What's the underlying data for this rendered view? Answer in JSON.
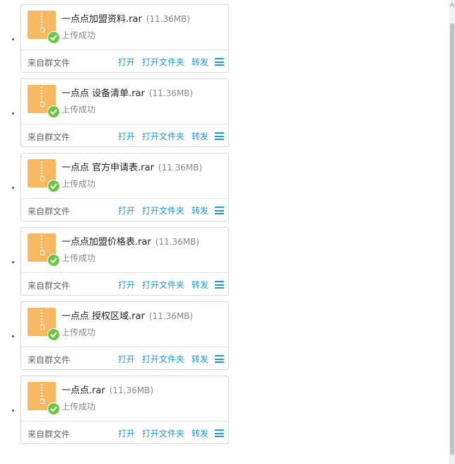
{
  "items": [
    {
      "name": "一点点加盟资料.rar",
      "size": "(11.36MB)",
      "status": "上传成功",
      "source": "来自群文件",
      "actions": [
        "打开",
        "打开文件夹",
        "转发"
      ]
    },
    {
      "name": "一点点 设备清单.rar",
      "size": "(11.36MB)",
      "status": "上传成功",
      "source": "来自群文件",
      "actions": [
        "打开",
        "打开文件夹",
        "转发"
      ]
    },
    {
      "name": "一点点 官方申请表.rar",
      "size": "(11.36MB)",
      "status": "上传成功",
      "source": "来自群文件",
      "actions": [
        "打开",
        "打开文件夹",
        "转发"
      ]
    },
    {
      "name": "一点点加盟价格表.rar",
      "size": "(11.36MB)",
      "status": "上传成功",
      "source": "来自群文件",
      "actions": [
        "打开",
        "打开文件夹",
        "转发"
      ]
    },
    {
      "name": "一点点 授权区域.rar",
      "size": "(11.36MB)",
      "status": "上传成功",
      "source": "来自群文件",
      "actions": [
        "打开",
        "打开文件夹",
        "转发"
      ]
    },
    {
      "name": "一点点.rar",
      "size": "(11.36MB)",
      "status": "上传成功",
      "source": "来自群文件",
      "actions": [
        "打开",
        "打开文件夹",
        "转发"
      ]
    }
  ],
  "icons": {
    "file": "zip-archive-icon",
    "status": "check-circle-icon",
    "menu": "hamburger-menu-icon"
  },
  "colors": {
    "accent": "#1f9bd1",
    "success": "#6cc644",
    "file_icon": "#f8b862"
  }
}
